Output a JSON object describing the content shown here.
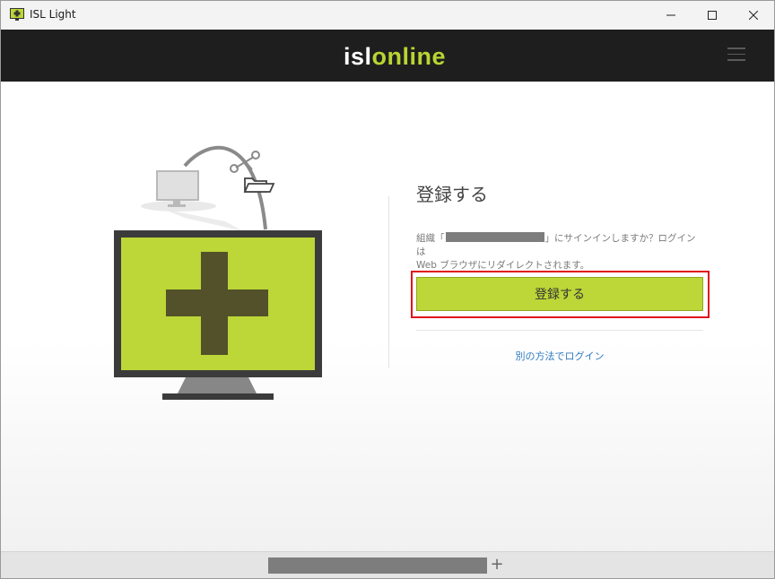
{
  "window": {
    "title": "ISL Light"
  },
  "header": {
    "logo_part1": "isl",
    "logo_part2": "online",
    "menu_icon": "hamburger-menu-icon"
  },
  "main": {
    "title": "登録する",
    "description_prefix": "組織「",
    "description_suffix": "」にサインインしますか？ログインは",
    "description_line2": "Web ブラウザにリダイレクトされます。",
    "signup_button": "登録する",
    "alt_login_link": "別の方法でログイン"
  },
  "tabbar": {
    "add_tab": "+"
  },
  "colors": {
    "accent": "#bcd737",
    "header_bg": "#1e1e1e",
    "link": "#2f7bbf",
    "highlight": "#e0141e"
  }
}
